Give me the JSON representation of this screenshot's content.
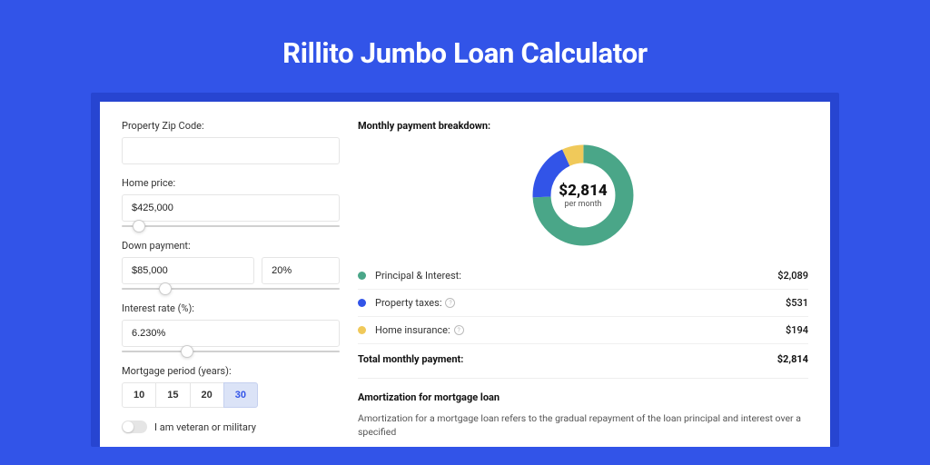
{
  "title": "Rillito Jumbo Loan Calculator",
  "colors": {
    "principal": "#4aa688",
    "taxes": "#3254e8",
    "insurance": "#f0c95a"
  },
  "form": {
    "zip": {
      "label": "Property Zip Code:",
      "value": ""
    },
    "price": {
      "label": "Home price:",
      "value": "$425,000",
      "slider_pos": 8
    },
    "down": {
      "label": "Down payment:",
      "amount": "$85,000",
      "percent": "20%",
      "slider_pos": 20
    },
    "rate": {
      "label": "Interest rate (%):",
      "value": "6.230%",
      "slider_pos": 30
    },
    "period": {
      "label": "Mortgage period (years):",
      "options": [
        "10",
        "15",
        "20",
        "30"
      ],
      "active_index": 3
    },
    "veteran": {
      "label": "I am veteran or military",
      "checked": false
    }
  },
  "breakdown": {
    "title": "Monthly payment breakdown:",
    "center_amount": "$2,814",
    "center_sub": "per month",
    "items": [
      {
        "label": "Principal & Interest:",
        "value": "$2,089",
        "color_key": "principal",
        "info": false
      },
      {
        "label": "Property taxes:",
        "value": "$531",
        "color_key": "taxes",
        "info": true
      },
      {
        "label": "Home insurance:",
        "value": "$194",
        "color_key": "insurance",
        "info": true
      }
    ],
    "total": {
      "label": "Total monthly payment:",
      "value": "$2,814"
    }
  },
  "amort": {
    "heading": "Amortization for mortgage loan",
    "text": "Amortization for a mortgage loan refers to the gradual repayment of the loan principal and interest over a specified"
  },
  "chart_data": {
    "type": "pie",
    "title": "Monthly payment breakdown",
    "series": [
      {
        "name": "Principal & Interest",
        "value": 2089
      },
      {
        "name": "Property taxes",
        "value": 531
      },
      {
        "name": "Home insurance",
        "value": 194
      }
    ],
    "total": 2814,
    "unit": "USD/month"
  }
}
